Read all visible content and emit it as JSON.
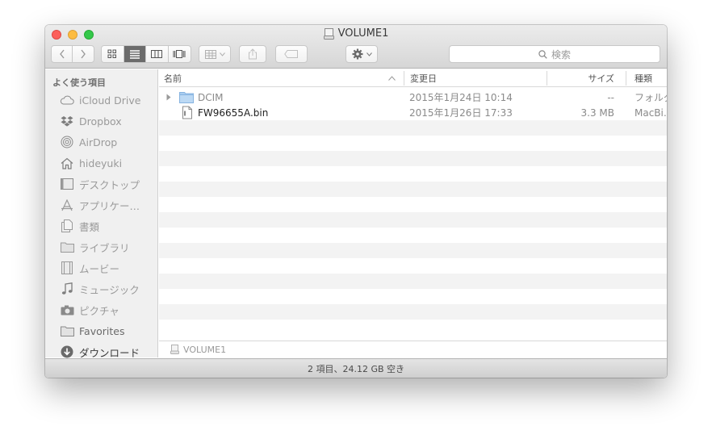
{
  "window": {
    "title": "VOLUME1"
  },
  "toolbar": {
    "search_placeholder": "検索"
  },
  "sidebar": {
    "heading": "よく使う項目",
    "items": [
      {
        "label": "iCloud Drive",
        "icon": "cloud-icon"
      },
      {
        "label": "Dropbox",
        "icon": "dropbox-icon"
      },
      {
        "label": "AirDrop",
        "icon": "airdrop-icon"
      },
      {
        "label": "hideyuki",
        "icon": "home-icon"
      },
      {
        "label": "デスクトップ",
        "icon": "desktop-icon"
      },
      {
        "label": "アプリケー…",
        "icon": "applications-icon"
      },
      {
        "label": "書類",
        "icon": "documents-icon"
      },
      {
        "label": "ライブラリ",
        "icon": "folder-icon"
      },
      {
        "label": "ムービー",
        "icon": "movies-icon"
      },
      {
        "label": "ミュージック",
        "icon": "music-icon"
      },
      {
        "label": "ピクチャ",
        "icon": "pictures-icon"
      },
      {
        "label": "Favorites",
        "icon": "folder-icon"
      },
      {
        "label": "ダウンロード",
        "icon": "downloads-icon"
      }
    ]
  },
  "columns": {
    "name": "名前",
    "modified": "変更日",
    "size": "サイズ",
    "kind": "種類"
  },
  "files": [
    {
      "name": "DCIM",
      "modified": "2015年1月24日 10:14",
      "size": "--",
      "kind": "フォルダ",
      "type": "folder"
    },
    {
      "name": "FW96655A.bin",
      "modified": "2015年1月26日 17:33",
      "size": "3.3 MB",
      "kind": "MacBi…",
      "type": "file"
    }
  ],
  "pathbar": {
    "label": "VOLUME1"
  },
  "status": {
    "text": "2 項目、24.12 GB 空き"
  },
  "colors": {
    "close": "#fc605b",
    "minimize": "#fdbc40",
    "maximize": "#34c84a",
    "folder": "#a9cdf0"
  }
}
